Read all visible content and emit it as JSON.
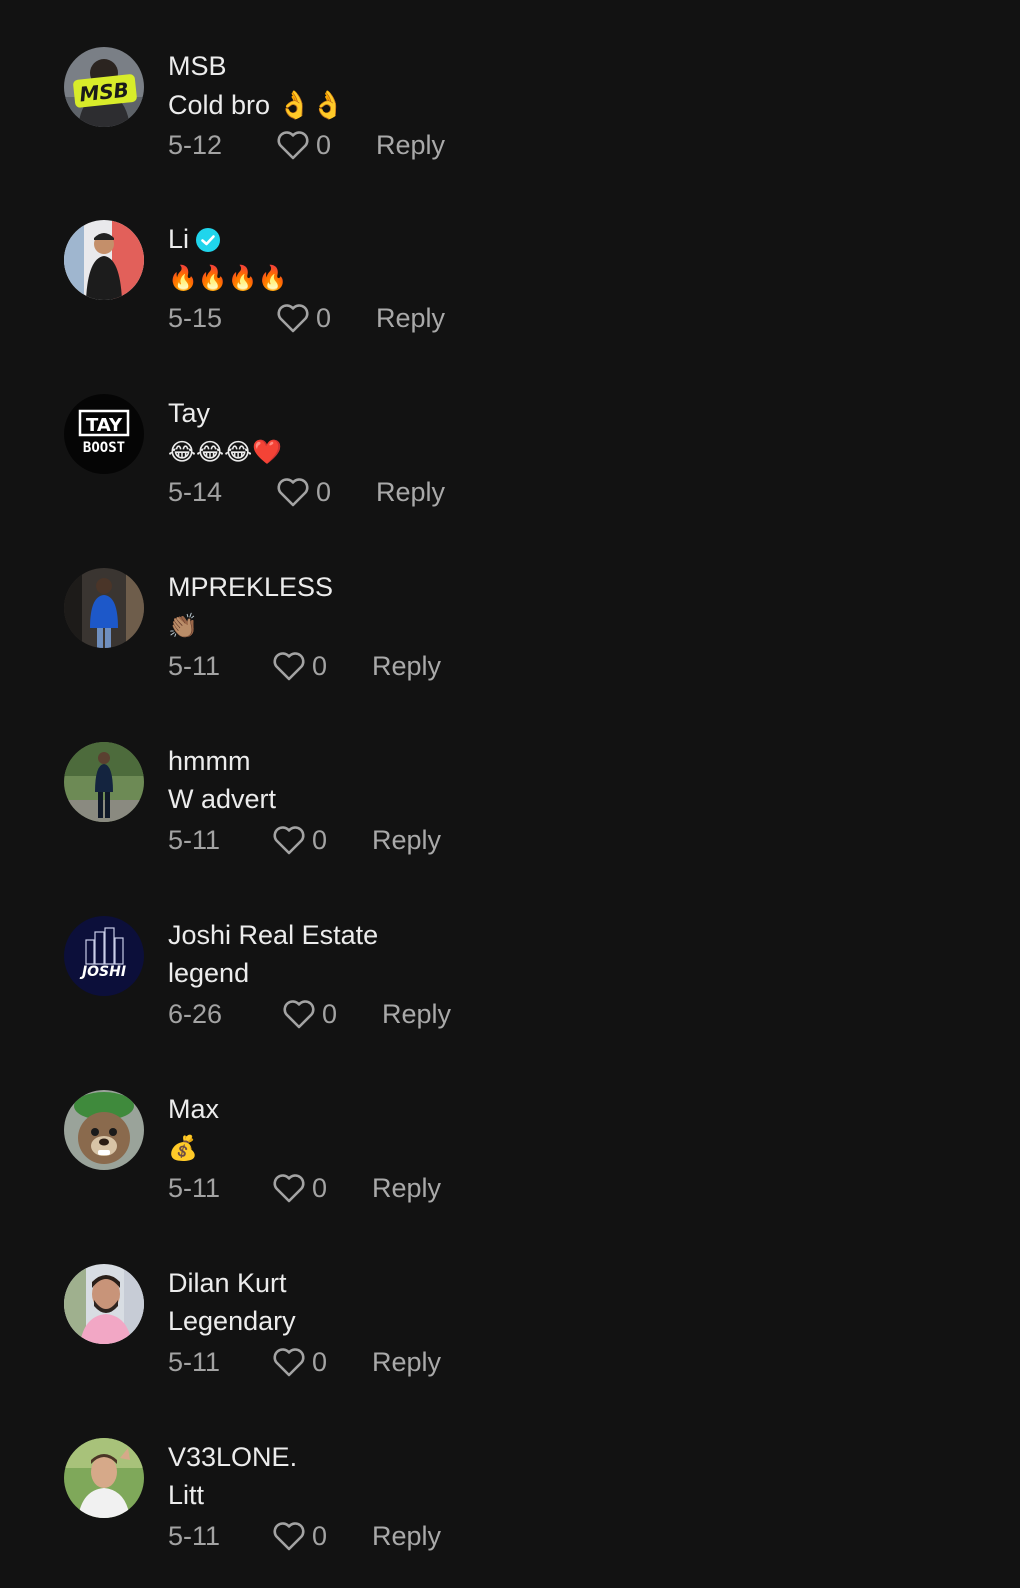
{
  "comments": [
    {
      "username": "MSB",
      "text": "Cold bro 👌👌",
      "date": "5-12",
      "likes": "0",
      "reply_label": "Reply",
      "verified": false,
      "avatar": "msb-avatar"
    },
    {
      "username": "Li",
      "text": "🔥🔥🔥🔥",
      "date": "5-15",
      "likes": "0",
      "reply_label": "Reply",
      "verified": true,
      "avatar": "li-avatar"
    },
    {
      "username": "Tay",
      "text": "😂😂😂❤️",
      "date": "5-14",
      "likes": "0",
      "reply_label": "Reply",
      "verified": false,
      "avatar": "tay-boost-avatar"
    },
    {
      "username": "MPREKLESS",
      "text": "👏🏽",
      "date": "5-11",
      "likes": "0",
      "reply_label": "Reply",
      "verified": false,
      "avatar": "mprekless-avatar"
    },
    {
      "username": "hmmm",
      "text": "W advert",
      "date": "5-11",
      "likes": "0",
      "reply_label": "Reply",
      "verified": false,
      "avatar": "hmmm-avatar"
    },
    {
      "username": "Joshi Real Estate",
      "text": "legend",
      "date": "6-26",
      "likes": "0",
      "reply_label": "Reply",
      "verified": false,
      "avatar": "joshi-avatar"
    },
    {
      "username": "Max",
      "text": "💰",
      "date": "5-11",
      "likes": "0",
      "reply_label": "Reply",
      "verified": false,
      "avatar": "max-avatar"
    },
    {
      "username": "Dilan Kurt",
      "text": "Legendary",
      "date": "5-11",
      "likes": "0",
      "reply_label": "Reply",
      "verified": false,
      "avatar": "dilan-avatar"
    },
    {
      "username": "V33LONE.",
      "text": "Litt",
      "date": "5-11",
      "likes": "0",
      "reply_label": "Reply",
      "verified": false,
      "avatar": "v33lone-avatar"
    }
  ],
  "avatar_logos": {
    "msb": "MSB",
    "tay_top": "TAY",
    "tay_bottom": "BOOST",
    "joshi": "JOSHI"
  },
  "colors": {
    "background": "#121212",
    "text_primary": "#ececec",
    "text_secondary": "#a3a3a3",
    "verified": "#20d5ec"
  }
}
